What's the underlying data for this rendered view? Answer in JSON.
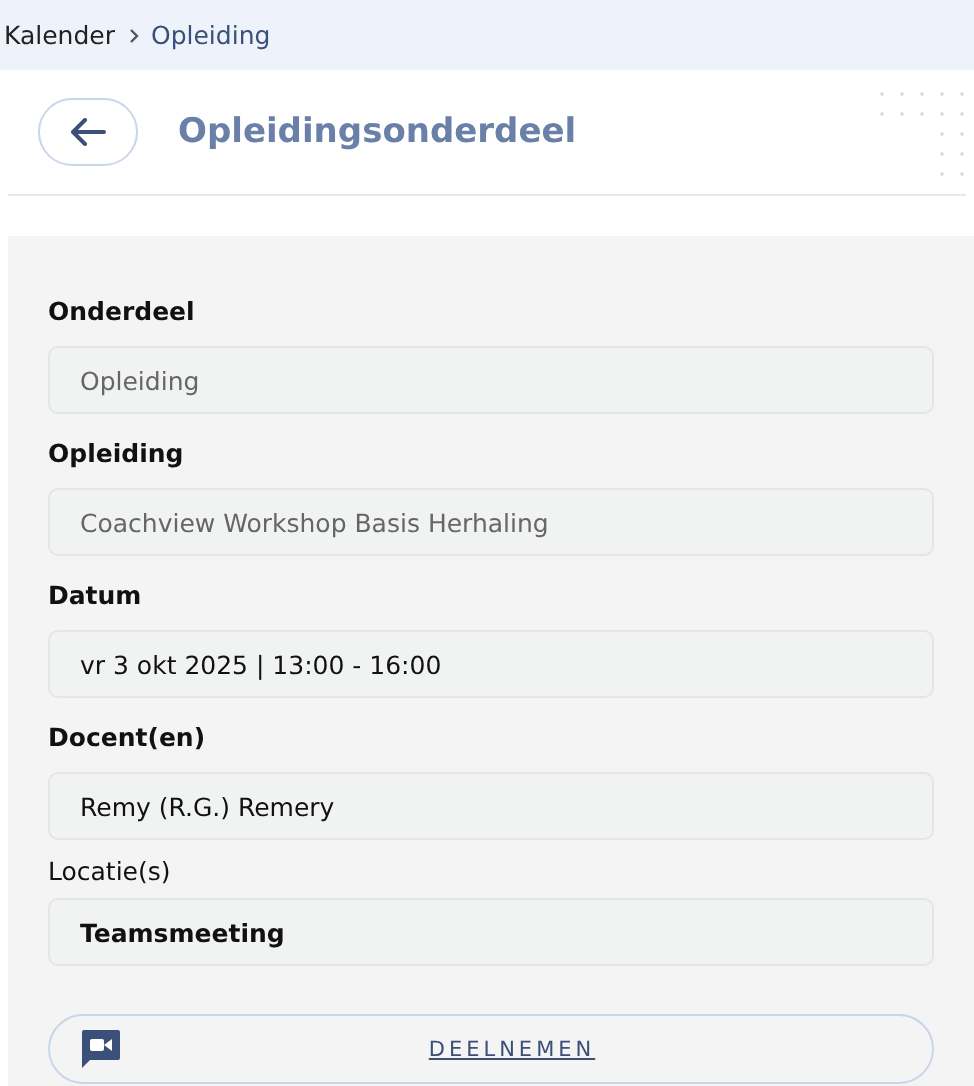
{
  "breadcrumb": [
    {
      "label": "Kalender",
      "selected": false
    },
    {
      "label": "Opleiding",
      "selected": true
    }
  ],
  "header": {
    "title": "Opleidingsonderdeel"
  },
  "fields": [
    {
      "kind": "field",
      "label": "Onderdeel",
      "value": "Opleiding",
      "disabled": true
    },
    {
      "kind": "field",
      "label": "Opleiding",
      "value": "Coachview Workshop Basis Herhaling",
      "disabled": true
    },
    {
      "kind": "field",
      "label": "Datum",
      "value": "vr 3 okt 2025 | 13:00 - 16:00",
      "disabled": false
    },
    {
      "kind": "field",
      "label": "Docent(en)",
      "value": "Remy (R.G.) Remery",
      "disabled": false
    },
    {
      "kind": "location",
      "label": "Locatie(s)",
      "value": "Teamsmeeting",
      "disabled": false
    }
  ],
  "join_button": {
    "label": "DEELNEMEN"
  }
}
